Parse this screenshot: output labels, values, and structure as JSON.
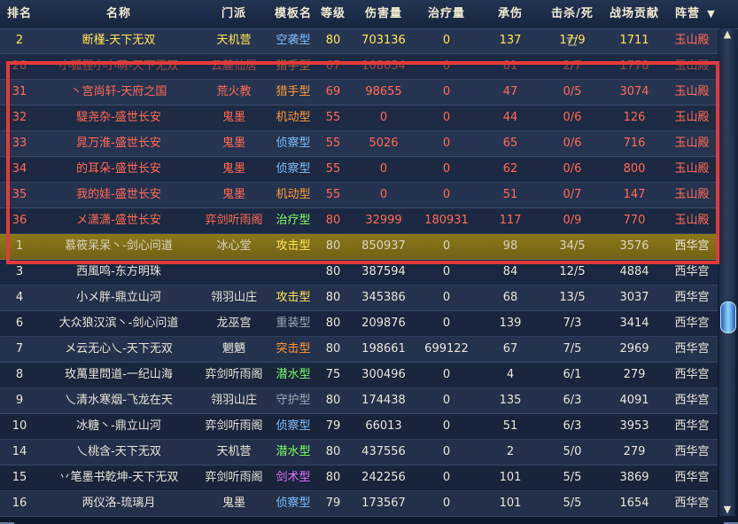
{
  "headers": {
    "rank": "排名",
    "name": "名称",
    "faction": "门派",
    "template": "模板名",
    "level": "等级",
    "damage": "伤害量",
    "heal": "治疗量",
    "taken": "承伤",
    "kd": "击杀/死亡",
    "contrib": "战场贡献",
    "camp": "阵营",
    "sort_icon": "chevron-down-icon"
  },
  "rows": [
    {
      "rank": "2",
      "name": "断槿-天下无双",
      "faction": "天机营",
      "template": "空袭型",
      "level": "80",
      "damage": "703136",
      "heal": "0",
      "taken": "137",
      "kd": "17/9",
      "contrib": "1711",
      "camp": "玉山殿"
    },
    {
      "rank": "28",
      "name": "小狐狸小小萌-天下无双",
      "faction": "云麓仙居",
      "template": "猎手型",
      "level": "67",
      "damage": "108654",
      "heal": "0",
      "taken": "81",
      "kd": "2/7",
      "contrib": "1778",
      "camp": "玉山殿"
    },
    {
      "rank": "31",
      "name": "丶宫尚轩-天府之国",
      "faction": "荒火教",
      "template": "猎手型",
      "level": "69",
      "damage": "98655",
      "heal": "0",
      "taken": "47",
      "kd": "0/5",
      "contrib": "3074",
      "camp": "玉山殿"
    },
    {
      "rank": "32",
      "name": "騠尧杂-盛世长安",
      "faction": "鬼墨",
      "template": "机动型",
      "level": "55",
      "damage": "0",
      "heal": "0",
      "taken": "44",
      "kd": "0/6",
      "contrib": "126",
      "camp": "玉山殿"
    },
    {
      "rank": "33",
      "name": "晁万淮-盛世长安",
      "faction": "鬼墨",
      "template": "侦察型",
      "level": "55",
      "damage": "5026",
      "heal": "0",
      "taken": "65",
      "kd": "0/6",
      "contrib": "716",
      "camp": "玉山殿"
    },
    {
      "rank": "34",
      "name": "的耳朵-盛世长安",
      "faction": "鬼墨",
      "template": "侦察型",
      "level": "55",
      "damage": "0",
      "heal": "0",
      "taken": "62",
      "kd": "0/6",
      "contrib": "800",
      "camp": "玉山殿"
    },
    {
      "rank": "35",
      "name": "我的娃-盛世长安",
      "faction": "鬼墨",
      "template": "机动型",
      "level": "55",
      "damage": "0",
      "heal": "0",
      "taken": "51",
      "kd": "0/7",
      "contrib": "147",
      "camp": "玉山殿"
    },
    {
      "rank": "36",
      "name": "メ潇潇-盛世长安",
      "faction": "弈剑听雨阁",
      "template": "治疗型",
      "level": "80",
      "damage": "32999",
      "heal": "180931",
      "taken": "117",
      "kd": "0/9",
      "contrib": "770",
      "camp": "玉山殿"
    },
    {
      "rank": "1",
      "name": "慕筱呆呆丶-剑心问道",
      "faction": "冰心堂",
      "template": "攻击型",
      "level": "80",
      "damage": "850937",
      "heal": "0",
      "taken": "98",
      "kd": "34/5",
      "contrib": "3576",
      "camp": "西华宫"
    },
    {
      "rank": "3",
      "name": "西風鸣-东方明珠",
      "faction": "",
      "template": "",
      "level": "80",
      "damage": "387594",
      "heal": "0",
      "taken": "84",
      "kd": "12/5",
      "contrib": "4884",
      "camp": "西华宫"
    },
    {
      "rank": "4",
      "name": "小メ胖-鼎立山河",
      "faction": "翎羽山庄",
      "template": "攻击型",
      "level": "80",
      "damage": "345386",
      "heal": "0",
      "taken": "68",
      "kd": "13/5",
      "contrib": "3037",
      "camp": "西华宫"
    },
    {
      "rank": "6",
      "name": "大众狼汉滨丶-剑心问道",
      "faction": "龙巫宫",
      "template": "重装型",
      "level": "80",
      "damage": "209876",
      "heal": "0",
      "taken": "139",
      "kd": "7/3",
      "contrib": "3414",
      "camp": "西华宫"
    },
    {
      "rank": "7",
      "name": "メ云无心乀-天下无双",
      "faction": "魍魉",
      "template": "突击型",
      "level": "80",
      "damage": "198661",
      "heal": "699122",
      "taken": "67",
      "kd": "7/5",
      "contrib": "2969",
      "camp": "西华宫"
    },
    {
      "rank": "8",
      "name": "玫萬里問道-一纪山海",
      "faction": "弈剑听雨阁",
      "template": "潜水型",
      "level": "75",
      "damage": "300496",
      "heal": "0",
      "taken": "4",
      "kd": "6/1",
      "contrib": "279",
      "camp": "西华宫"
    },
    {
      "rank": "9",
      "name": "乀清水寒烟-飞龙在天",
      "faction": "翎羽山庄",
      "template": "守护型",
      "level": "80",
      "damage": "174438",
      "heal": "0",
      "taken": "135",
      "kd": "6/3",
      "contrib": "4091",
      "camp": "西华宫"
    },
    {
      "rank": "10",
      "name": "冰糖丶-鼎立山河",
      "faction": "弈剑听雨阁",
      "template": "侦察型",
      "level": "79",
      "damage": "66013",
      "heal": "0",
      "taken": "51",
      "kd": "6/3",
      "contrib": "3953",
      "camp": "西华宫"
    },
    {
      "rank": "14",
      "name": "乀桃含-天下无双",
      "faction": "天机营",
      "template": "潜水型",
      "level": "80",
      "damage": "437556",
      "heal": "0",
      "taken": "2",
      "kd": "5/0",
      "contrib": "279",
      "camp": "西华宫"
    },
    {
      "rank": "15",
      "name": "丷笔墨书乾坤-天下无双",
      "faction": "弈剑听雨阁",
      "template": "剑术型",
      "level": "80",
      "damage": "242256",
      "heal": "0",
      "taken": "101",
      "kd": "5/5",
      "contrib": "3869",
      "camp": "西华宫"
    },
    {
      "rank": "16",
      "name": "两仪洛-琉璃月",
      "faction": "鬼墨",
      "template": "侦察型",
      "level": "79",
      "damage": "173567",
      "heal": "0",
      "taken": "101",
      "kd": "5/5",
      "contrib": "1654",
      "camp": "西华宫"
    }
  ],
  "styles": {
    "name_colors": [
      "yel",
      "red",
      "red",
      "red",
      "red",
      "red",
      "red",
      "red",
      "blk",
      "wht",
      "wht",
      "wht",
      "wht",
      "wht",
      "wht",
      "wht",
      "wht",
      "wht",
      "wht"
    ],
    "template_colors": [
      "blue",
      "orange",
      "orange",
      "orange",
      "blue",
      "blue",
      "orange",
      "green",
      "yellow",
      "gray",
      "yellow",
      "gray",
      "orange",
      "green",
      "gray",
      "blue",
      "green",
      "purple",
      "blue"
    ],
    "highlight_color": "#e23a3a",
    "self_row_color": "#8a7a1c"
  },
  "scrollbar": {
    "up_icon": "scroll-up-arrow-icon",
    "down_icon": "scroll-down-arrow-icon"
  }
}
